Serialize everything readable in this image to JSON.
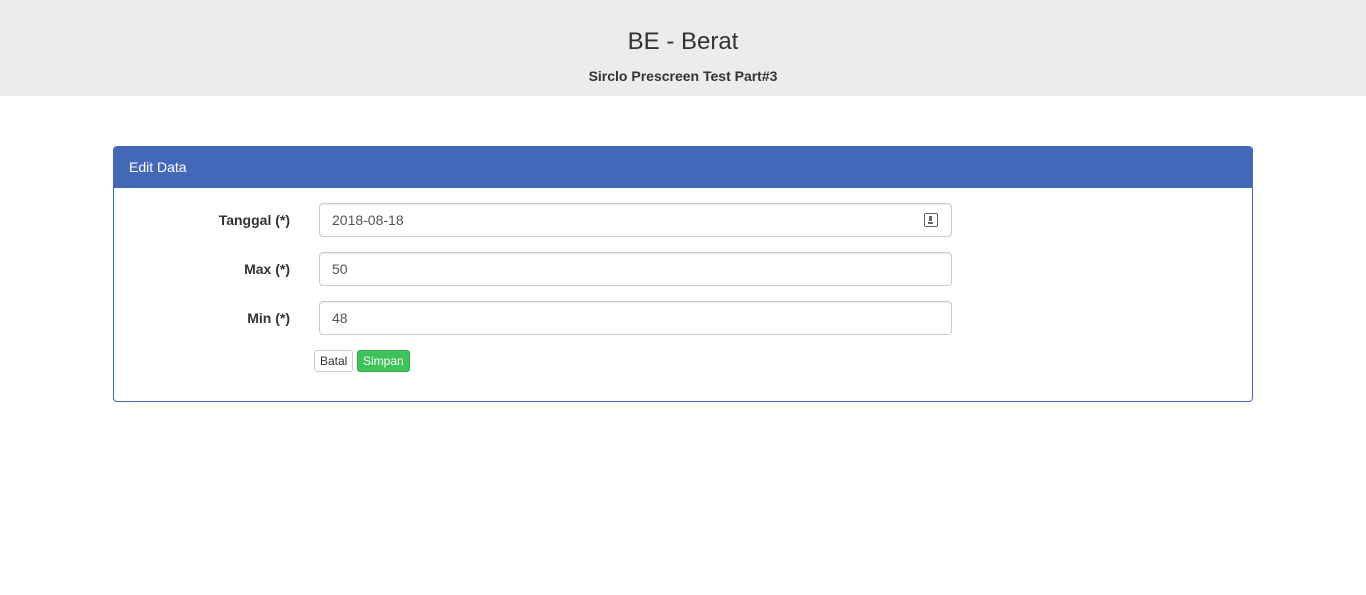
{
  "header": {
    "title": "BE - Berat",
    "subtitle": "Sirclo Prescreen Test Part#3"
  },
  "panel": {
    "heading": "Edit Data"
  },
  "form": {
    "tanggal": {
      "label": "Tanggal (*)",
      "value": "2018-08-18",
      "icon": "calendar-icon"
    },
    "max": {
      "label": "Max (*)",
      "value": "50"
    },
    "min": {
      "label": "Min (*)",
      "value": "48"
    }
  },
  "buttons": {
    "cancel_label": "Batal",
    "save_label": "Simpan"
  },
  "colors": {
    "primary": "#4468b8",
    "success": "#3cc35a",
    "header_bg": "#ececec"
  }
}
